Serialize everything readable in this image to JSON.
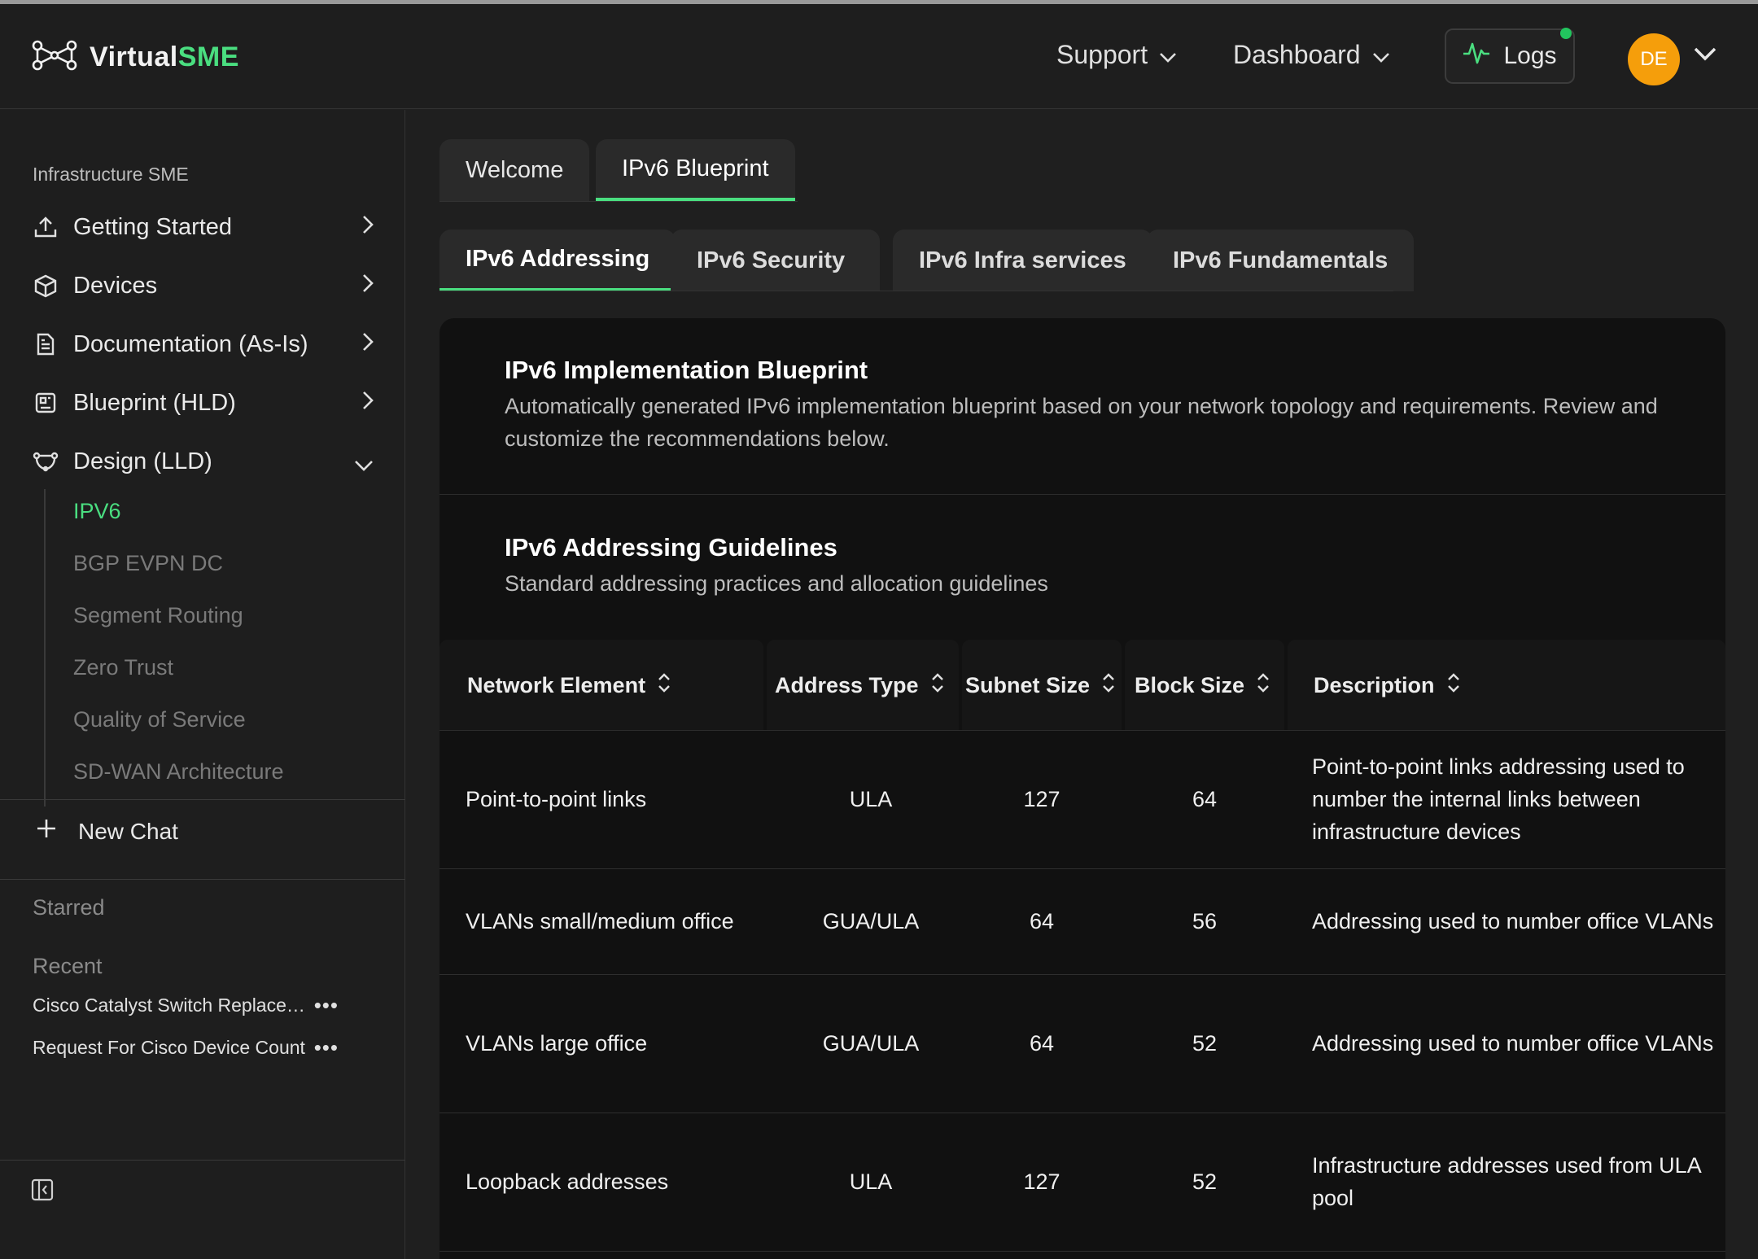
{
  "app": {
    "brand_part1": "Virtual",
    "brand_part2": "SME"
  },
  "header": {
    "support": "Support",
    "dashboard": "Dashboard",
    "logs": "Logs",
    "avatar_initials": "DE"
  },
  "sidebar": {
    "section_title": "Infrastructure SME",
    "items": [
      {
        "label": "Getting Started",
        "icon": "upload-icon"
      },
      {
        "label": "Devices",
        "icon": "cube-icon"
      },
      {
        "label": "Documentation (As-Is)",
        "icon": "document-icon"
      },
      {
        "label": "Blueprint (HLD)",
        "icon": "blueprint-icon"
      },
      {
        "label": "Design (LLD)",
        "icon": "design-icon"
      }
    ],
    "sub_items": [
      "IPV6",
      "BGP EVPN DC",
      "Segment Routing",
      "Zero Trust",
      "Quality of Service",
      "SD-WAN Architecture"
    ],
    "new_chat": "New Chat",
    "starred": "Starred",
    "recent": "Recent",
    "recent_items": [
      "Cisco Catalyst Switch Replacement",
      "Request For Cisco Device Count"
    ],
    "more": "•••"
  },
  "tabs": {
    "top": [
      "Welcome",
      "IPv6 Blueprint"
    ],
    "sub": [
      "IPv6 Addressing",
      "IPv6 Security",
      "IPv6 Infra services",
      "IPv6 Fundamentals"
    ]
  },
  "panel": {
    "title": "IPv6 Implementation Blueprint",
    "description": "Automatically generated IPv6 implementation blueprint based on your network topology and requirements. Review and customize the recommendations below.",
    "guidelines_title": "IPv6 Addressing Guidelines",
    "guidelines_desc": "Standard addressing practices and allocation guidelines"
  },
  "table": {
    "headers": [
      "Network Element",
      "Address Type",
      "Subnet Size",
      "Block Size",
      "Description"
    ],
    "rows": [
      {
        "element": "Point-to-point links",
        "type": "ULA",
        "subnet": "127",
        "block": "64",
        "desc": "Point-to-point links addressing used to number the internal links between infrastructure devices"
      },
      {
        "element": "VLANs small/medium office",
        "type": "GUA/ULA",
        "subnet": "64",
        "block": "56",
        "desc": "Addressing used to number office VLANs"
      },
      {
        "element": "VLANs large office",
        "type": "GUA/ULA",
        "subnet": "64",
        "block": "52",
        "desc": "Addressing used to number office VLANs"
      },
      {
        "element": "Loopback addresses",
        "type": "ULA",
        "subnet": "127",
        "block": "52",
        "desc": "Infrastructure addresses used from ULA pool"
      }
    ]
  },
  "colors": {
    "accent": "#4ade80",
    "avatar": "#f59e0b",
    "background": "#1f1f1f"
  }
}
